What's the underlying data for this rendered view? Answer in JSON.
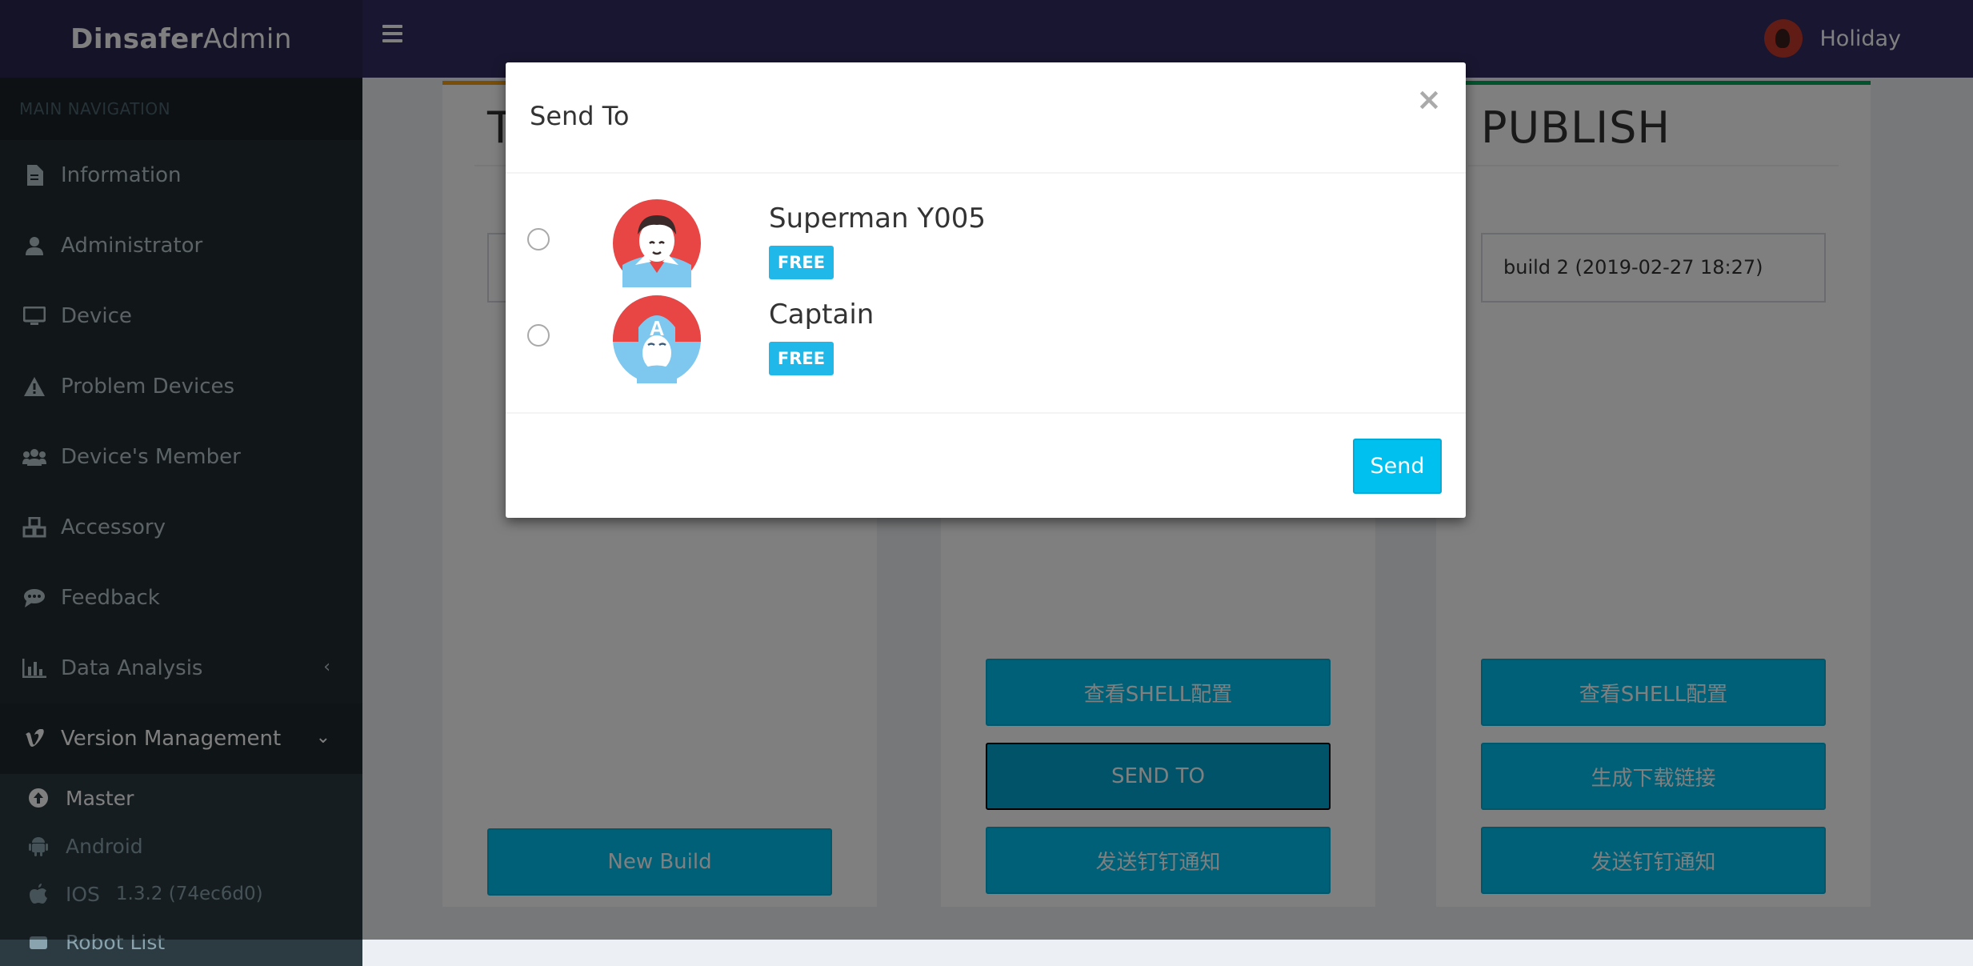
{
  "app": {
    "logo_bold": "Dinsafer",
    "logo_light": "Admin",
    "user_name": "Holiday"
  },
  "sidebar": {
    "header": "MAIN NAVIGATION",
    "items": [
      {
        "label": "Information",
        "icon": "file-icon"
      },
      {
        "label": "Administrator",
        "icon": "user-icon"
      },
      {
        "label": "Device",
        "icon": "monitor-icon"
      },
      {
        "label": "Problem Devices",
        "icon": "warning-icon"
      },
      {
        "label": "Device's Member",
        "icon": "users-icon"
      },
      {
        "label": "Accessory",
        "icon": "cubes-icon"
      },
      {
        "label": "Feedback",
        "icon": "comment-icon"
      },
      {
        "label": "Data Analysis",
        "icon": "bar-chart-icon"
      },
      {
        "label": "Version Management",
        "icon": "vimeo-icon"
      }
    ],
    "sub_items": [
      {
        "label": "Master",
        "icon": "arrow-circle-up-icon"
      },
      {
        "label": "Android",
        "icon": "android-icon"
      },
      {
        "label": "IOS",
        "icon": "apple-icon",
        "extra": "1.3.2 (74ec6d0)"
      },
      {
        "label": "Robot List",
        "icon": "robot-icon"
      }
    ]
  },
  "boxes": [
    {
      "title": "T",
      "buttons": [
        "New Build"
      ]
    },
    {
      "title": "",
      "buttons": [
        "查看SHELL配置",
        "SEND TO",
        "发送钉钉通知"
      ]
    },
    {
      "title": "PUBLISH",
      "select_value": "build 2 (2019-02-27 18:27)",
      "buttons": [
        "查看SHELL配置",
        "生成下载链接",
        "发送钉钉通知"
      ]
    }
  ],
  "modal": {
    "title": "Send To",
    "close": "×",
    "members": [
      {
        "name": "Superman Y005",
        "badge": "FREE"
      },
      {
        "name": "Captain",
        "badge": "FREE"
      }
    ],
    "send_label": "Send"
  },
  "colors": {
    "header_bg": "#322c63",
    "logo_bg": "#2b2651",
    "sidebar_bg": "#222d32",
    "accent": "#00c0ef",
    "badge": "#1fb8e8"
  }
}
